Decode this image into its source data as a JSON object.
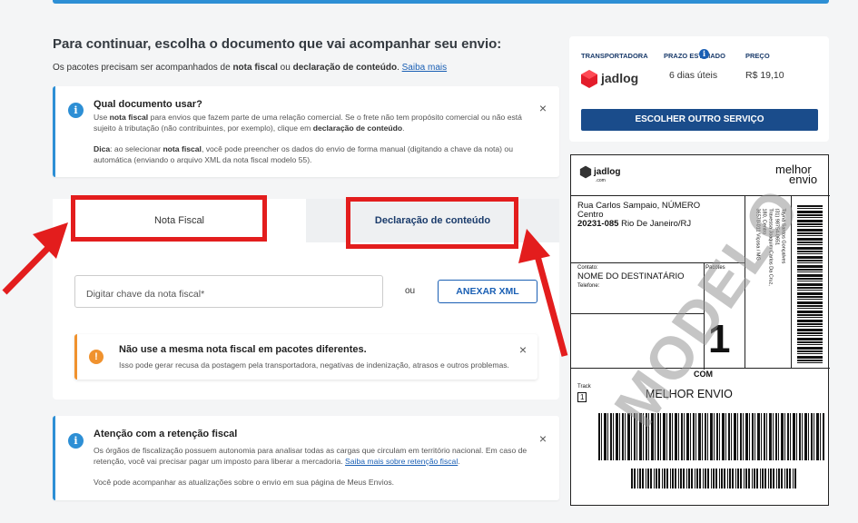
{
  "header": {
    "title": "Para continuar, escolha o documento que vai acompanhar seu envio:",
    "subtitle_prefix": "Os pacotes precisam ser acompanhados de ",
    "subtitle_bold1": "nota fiscal",
    "subtitle_mid": " ou ",
    "subtitle_bold2": "declaração de conteúdo",
    "subtitle_suffix": ".",
    "link": "Saiba mais"
  },
  "info_box": {
    "title": "Qual documento usar?",
    "line1_prefix": "Use ",
    "line1_bold": "nota fiscal",
    "line1_rest": " para envios que fazem parte de uma relação comercial. Se o frete não tem propósito comercial ou não está",
    "line2_prefix": "sujeito à tributação (não contribuintes, por exemplo), clique em ",
    "line2_bold": "declaração de conteúdo",
    "line2_suffix": ".",
    "tip_label": "Dica",
    "tip_prefix": ": ao selecionar ",
    "tip_bold": "nota fiscal",
    "tip_rest": ", você pode preencher os dados do envio de forma manual (digitando a chave da nota) ou",
    "tip_line2": "automática (enviando o arquivo XML da nota fiscal modelo 55).",
    "close": "×"
  },
  "tabs": {
    "nota": "Nota Fiscal",
    "declaracao": "Declaração de conteúdo"
  },
  "form": {
    "key_placeholder": "Digitar chave da nota fiscal*",
    "or": "ou",
    "attach_button": "ANEXAR XML"
  },
  "warning": {
    "icon": "!",
    "title": "Não use a mesma nota fiscal em pacotes diferentes.",
    "body": "Isso pode gerar recusa da postagem pela transportadora, negativas de indenização, atrasos e outros problemas.",
    "close": "×"
  },
  "retention_box": {
    "title": "Atenção com a retenção fiscal",
    "line1": "Os órgãos de fiscalização possuem autonomia para analisar todas as cargas que circulam em território nacional. Em caso de",
    "line2_prefix": "retenção, você vai precisar pagar um imposto para liberar a mercadoria. ",
    "line2_link": "Saiba mais sobre retenção fiscal",
    "line2_suffix": ".",
    "line3": "Você pode acompanhar as atualizações sobre o envio em sua página de Meus Envios.",
    "close": "×"
  },
  "carrier": {
    "label_transportadora": "TRANSPORTADORA",
    "label_prazo": "PRAZO ESTIMADO",
    "label_preco": "PREÇO",
    "name": "jadlog",
    "prazo": "6 dias úteis",
    "preco": "R$ 19,10",
    "button": "ESCOLHER OUTRO SERVIÇO",
    "brand_color": "#e31d2b"
  },
  "label_preview": {
    "carrier_logo": "jadlog",
    "carrier_sub": ".com",
    "brand_line1": "melhor",
    "brand_line2": "envio",
    "address_line1": "Rua Carlos Sampaio, NÚMERO",
    "address_line2": "Centro",
    "address_cep": "20231-085",
    "address_city": " Rio De Janeiro/RJ",
    "contact_label": "Contato:",
    "recipient": "NOME DO DESTINATÁRIO",
    "phone_label": "Telefone:",
    "pacotes_label": "Pacotes",
    "pacotes_value": "1",
    "service": "COM",
    "track_label": "Track",
    "track_value": "1",
    "track_sender": "MELHOR ENVIO",
    "sender_vertical_1": "Tayná Santos Gonçalves",
    "sender_vertical_2": "(31) 98754-0651",
    "sender_vertical_3": "Travessa Joaquim Carlos Da Cruz,",
    "sender_vertical_4": "180, Centro",
    "sender_vertical_5": "36570-011 Viçosa / MG",
    "watermark": "MODELO"
  }
}
